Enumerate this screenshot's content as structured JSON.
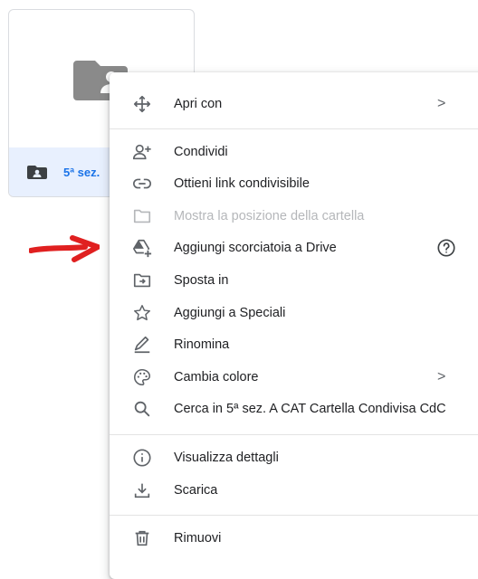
{
  "tile": {
    "name": "5ª sez."
  },
  "menu": {
    "items": [
      {
        "label": "Apri con",
        "icon": "open-with-icon",
        "submenu": true
      },
      {
        "label": "Condividi",
        "icon": "person-add-icon"
      },
      {
        "label": "Ottieni link condivisibile",
        "icon": "link-icon"
      },
      {
        "label": "Mostra la posizione della cartella",
        "icon": "folder-outline-icon",
        "disabled": true
      },
      {
        "label": "Aggiungi scorciatoia a Drive",
        "icon": "drive-add-shortcut-icon",
        "help": true
      },
      {
        "label": "Sposta in",
        "icon": "move-to-folder-icon"
      },
      {
        "label": "Aggiungi a Speciali",
        "icon": "star-outline-icon"
      },
      {
        "label": "Rinomina",
        "icon": "pencil-icon"
      },
      {
        "label": "Cambia colore",
        "icon": "palette-icon",
        "submenu": true
      },
      {
        "label": "Cerca in 5ª sez. A CAT Cartella Condivisa CdC",
        "icon": "search-icon"
      },
      {
        "label": "Visualizza dettagli",
        "icon": "info-icon"
      },
      {
        "label": "Scarica",
        "icon": "download-icon"
      },
      {
        "label": "Rimuovi",
        "icon": "trash-icon"
      }
    ],
    "chevron": ">"
  },
  "colors": {
    "icon": "#5f6368",
    "disabled": "#b5b7ba",
    "accent": "#1a73e8",
    "annotation_arrow": "#e02020",
    "tile_footer": "#e8f0fe"
  }
}
